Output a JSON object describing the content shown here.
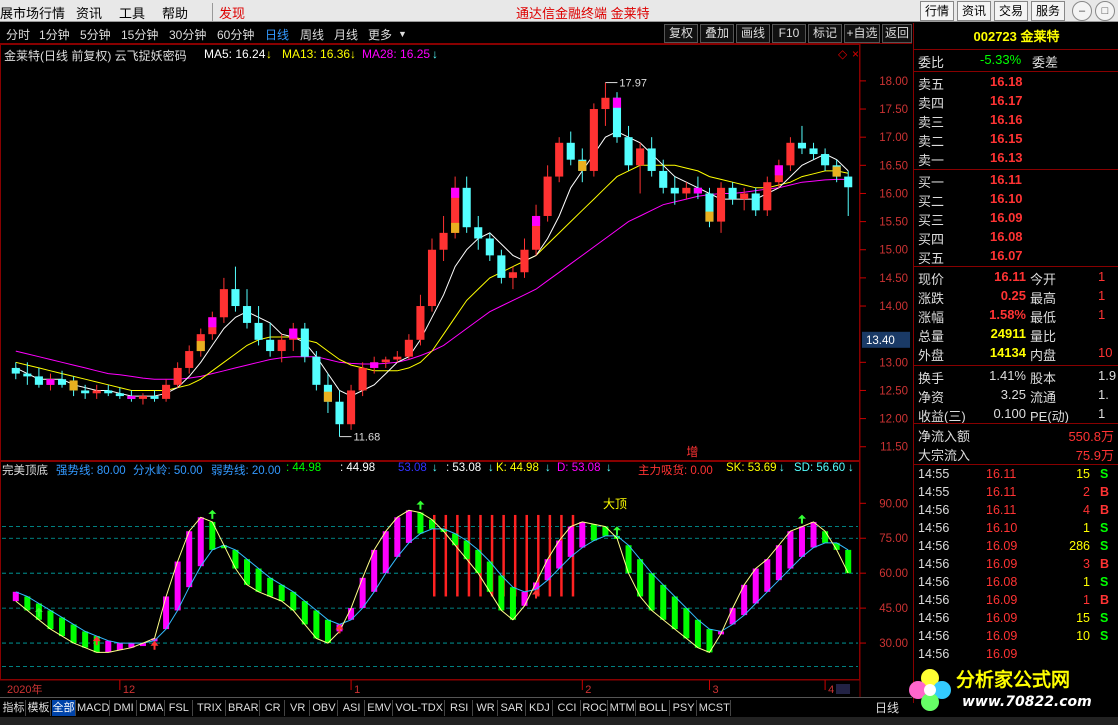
{
  "menu": {
    "items": [
      "展市场行情",
      "资讯",
      "工具",
      "帮助"
    ],
    "discover": "发现",
    "center_title": "通达信金融终端  金莱特",
    "right_buttons": [
      "行情",
      "资讯",
      "交易",
      "服务"
    ]
  },
  "period_bar": {
    "periods": [
      "分时",
      "1分钟",
      "5分钟",
      "15分钟",
      "30分钟",
      "60分钟",
      "日线",
      "周线",
      "月线",
      "更多"
    ],
    "active": "日线",
    "tools": [
      "复权",
      "叠加",
      "画线",
      "F10",
      "标记",
      "+自选",
      "返回"
    ]
  },
  "main_header": {
    "title": "金莱特(日线 前复权) 云飞捉妖密码",
    "ma5": "MA5: 16.24",
    "ma13": "MA13: 16.36",
    "ma28": "MA28: 16.25"
  },
  "price_axis": [
    "18.00",
    "17.50",
    "17.00",
    "16.50",
    "16.00",
    "15.50",
    "15.00",
    "14.50",
    "14.00",
    "13.40",
    "13.00",
    "12.50",
    "12.00",
    "11.50"
  ],
  "current_price_label": "13.40",
  "annotations": {
    "high": "17.97",
    "low": "11.68",
    "zeng": "增",
    "dading": "大顶"
  },
  "sub_header": {
    "name": "完美顶底",
    "strong": "强势线: 80.00",
    "water": "分水岭: 50.00",
    "weak": "弱势线: 20.00",
    "v1": ": 44.98",
    "v2": ": 44.98",
    "v3": "53.08",
    "v4": ": 53.08",
    "k": "K: 44.98",
    "d": "D: 53.08",
    "main": "主力吸货: 0.00",
    "sk": "SK: 53.69",
    "sd": "SD: 56.60"
  },
  "sub_axis": [
    "90.00",
    "75.00",
    "60.00",
    "45.00",
    "30.00"
  ],
  "date_axis": {
    "labels": [
      "2020年",
      "12",
      "1",
      "2",
      "3",
      "4"
    ]
  },
  "bottom_tabs": [
    "指标",
    "模板",
    "全部",
    "MACD",
    "DMI",
    "DMA",
    "FSL",
    "TRIX",
    "BRAR",
    "CR",
    "VR",
    "OBV",
    "ASI",
    "EMV",
    "VOL-TDX",
    "RSI",
    "WR",
    "SAR",
    "KDJ",
    "CCI",
    "ROC",
    "MTM",
    "BOLL",
    "PSY",
    "MCST"
  ],
  "bottom_active": "全部",
  "bottom_right": "日线",
  "quote": {
    "code": "002723 金莱特",
    "weibi_label": "委比",
    "weibi_value": "-5.33%",
    "weicha_label": "委差",
    "asks": [
      {
        "label": "卖五",
        "price": "16.18"
      },
      {
        "label": "卖四",
        "price": "16.17"
      },
      {
        "label": "卖三",
        "price": "16.16"
      },
      {
        "label": "卖二",
        "price": "16.15"
      },
      {
        "label": "卖一",
        "price": "16.13"
      }
    ],
    "bids": [
      {
        "label": "买一",
        "price": "16.11"
      },
      {
        "label": "买二",
        "price": "16.10"
      },
      {
        "label": "买三",
        "price": "16.09"
      },
      {
        "label": "买四",
        "price": "16.08"
      },
      {
        "label": "买五",
        "price": "16.07"
      }
    ],
    "stats": [
      {
        "l1": "现价",
        "v1": "16.11",
        "l2": "今开",
        "v2": "1"
      },
      {
        "l1": "涨跌",
        "v1": "0.25",
        "l2": "最高",
        "v2": "1"
      },
      {
        "l1": "涨幅",
        "v1": "1.58%",
        "l2": "最低",
        "v2": "1"
      },
      {
        "l1": "总量",
        "v1": "24911",
        "l2": "量比",
        "v2": ""
      },
      {
        "l1": "外盘",
        "v1": "14134",
        "l2": "内盘",
        "v2": "10"
      }
    ],
    "stats2": [
      {
        "l1": "换手",
        "v1": "1.41%",
        "l2": "股本",
        "v2": "1.9"
      },
      {
        "l1": "净资",
        "v1": "3.25",
        "l2": "流通",
        "v2": "1."
      },
      {
        "l1": "收益(三)",
        "v1": "0.100",
        "l2": "PE(动)",
        "v2": "1"
      }
    ],
    "flow": [
      {
        "label": "净流入额",
        "value": "550.8万"
      },
      {
        "label": "大宗流入",
        "value": "75.9万"
      }
    ],
    "ticks": [
      {
        "time": "14:55",
        "price": "16.11",
        "vol": "15",
        "side": "S"
      },
      {
        "time": "14:55",
        "price": "16.11",
        "vol": "2",
        "side": "B"
      },
      {
        "time": "14:56",
        "price": "16.11",
        "vol": "4",
        "side": "B"
      },
      {
        "time": "14:56",
        "price": "16.10",
        "vol": "1",
        "side": "S"
      },
      {
        "time": "14:56",
        "price": "16.09",
        "vol": "286",
        "side": "S"
      },
      {
        "time": "14:56",
        "price": "16.09",
        "vol": "3",
        "side": "B"
      },
      {
        "time": "14:56",
        "price": "16.08",
        "vol": "1",
        "side": "S"
      },
      {
        "time": "14:56",
        "price": "16.09",
        "vol": "1",
        "side": "B"
      },
      {
        "time": "14:56",
        "price": "16.09",
        "vol": "15",
        "side": "S"
      },
      {
        "time": "14:56",
        "price": "16.09",
        "vol": "10",
        "side": "S"
      },
      {
        "time": "14:56",
        "price": "16.09",
        "vol": "",
        "side": ""
      }
    ]
  },
  "watermark": {
    "text": "分析家公式网",
    "url": "www.70822.com"
  },
  "colors": {
    "up": "#ff3232",
    "down": "#54ffff",
    "ma5": "#ffffff",
    "ma13": "#ffff00",
    "ma28": "#ff00ff",
    "green": "#00ff00",
    "magenta": "#ff00ff"
  },
  "chart_data": {
    "type": "candlestick",
    "price_range": [
      11.3,
      18.3
    ],
    "candles": [
      [
        12.9,
        13.0,
        12.7,
        12.8
      ],
      [
        12.8,
        13.0,
        12.6,
        12.75
      ],
      [
        12.75,
        12.9,
        12.55,
        12.6
      ],
      [
        12.6,
        12.8,
        12.5,
        12.7
      ],
      [
        12.7,
        12.85,
        12.55,
        12.6
      ],
      [
        12.6,
        12.75,
        12.4,
        12.5
      ],
      [
        12.5,
        12.6,
        12.35,
        12.45
      ],
      [
        12.45,
        12.6,
        12.35,
        12.5
      ],
      [
        12.5,
        12.6,
        12.4,
        12.45
      ],
      [
        12.45,
        12.55,
        12.35,
        12.4
      ],
      [
        12.4,
        12.5,
        12.3,
        12.35
      ],
      [
        12.35,
        12.45,
        12.25,
        12.4
      ],
      [
        12.4,
        12.5,
        12.3,
        12.35
      ],
      [
        12.35,
        12.7,
        12.3,
        12.6
      ],
      [
        12.6,
        13.0,
        12.55,
        12.9
      ],
      [
        12.9,
        13.3,
        12.8,
        13.2
      ],
      [
        13.2,
        13.6,
        13.1,
        13.5
      ],
      [
        13.5,
        13.9,
        13.4,
        13.8
      ],
      [
        13.8,
        14.5,
        13.7,
        14.3
      ],
      [
        14.3,
        14.7,
        13.9,
        14.0
      ],
      [
        14.0,
        14.3,
        13.6,
        13.7
      ],
      [
        13.7,
        14.0,
        13.3,
        13.4
      ],
      [
        13.4,
        13.7,
        13.1,
        13.2
      ],
      [
        13.2,
        13.5,
        13.0,
        13.4
      ],
      [
        13.4,
        13.7,
        13.2,
        13.6
      ],
      [
        13.6,
        13.7,
        13.0,
        13.1
      ],
      [
        13.1,
        13.2,
        12.5,
        12.6
      ],
      [
        12.6,
        12.8,
        12.1,
        12.3
      ],
      [
        12.3,
        12.5,
        11.68,
        11.9
      ],
      [
        11.9,
        12.6,
        11.8,
        12.5
      ],
      [
        12.5,
        13.0,
        12.4,
        12.9
      ],
      [
        12.9,
        13.1,
        12.8,
        13.0
      ],
      [
        13.0,
        13.1,
        12.9,
        13.05
      ],
      [
        13.05,
        13.2,
        13.0,
        13.1
      ],
      [
        13.1,
        13.5,
        13.05,
        13.4
      ],
      [
        13.4,
        14.2,
        13.3,
        14.0
      ],
      [
        14.0,
        15.2,
        13.9,
        15.0
      ],
      [
        15.0,
        15.6,
        14.8,
        15.3
      ],
      [
        15.3,
        16.3,
        15.2,
        16.1
      ],
      [
        16.1,
        16.3,
        15.3,
        15.4
      ],
      [
        15.4,
        15.6,
        15.0,
        15.2
      ],
      [
        15.2,
        15.3,
        14.8,
        14.9
      ],
      [
        14.9,
        15.0,
        14.4,
        14.5
      ],
      [
        14.5,
        14.7,
        14.3,
        14.6
      ],
      [
        14.6,
        15.2,
        14.5,
        15.0
      ],
      [
        15.0,
        15.8,
        14.9,
        15.6
      ],
      [
        15.6,
        16.5,
        15.5,
        16.3
      ],
      [
        16.3,
        17.0,
        16.2,
        16.9
      ],
      [
        16.9,
        17.1,
        16.5,
        16.6
      ],
      [
        16.6,
        16.8,
        16.2,
        16.4
      ],
      [
        16.4,
        17.6,
        16.3,
        17.5
      ],
      [
        17.5,
        17.97,
        17.2,
        17.7
      ],
      [
        17.7,
        17.8,
        16.9,
        17.0
      ],
      [
        17.0,
        17.2,
        16.4,
        16.5
      ],
      [
        16.5,
        16.9,
        16.0,
        16.8
      ],
      [
        16.8,
        17.0,
        16.3,
        16.4
      ],
      [
        16.4,
        16.6,
        16.0,
        16.1
      ],
      [
        16.1,
        16.3,
        15.8,
        16.0
      ],
      [
        16.0,
        16.2,
        15.9,
        16.1
      ],
      [
        16.1,
        16.3,
        15.9,
        16.0
      ],
      [
        16.0,
        16.1,
        15.4,
        15.5
      ],
      [
        15.5,
        16.2,
        15.3,
        16.1
      ],
      [
        16.1,
        16.2,
        15.8,
        15.9
      ],
      [
        15.9,
        16.1,
        15.7,
        16.0
      ],
      [
        16.0,
        16.1,
        15.6,
        15.7
      ],
      [
        15.7,
        16.3,
        15.6,
        16.2
      ],
      [
        16.2,
        16.6,
        16.1,
        16.5
      ],
      [
        16.5,
        17.0,
        16.4,
        16.9
      ],
      [
        16.9,
        17.2,
        16.7,
        16.8
      ],
      [
        16.8,
        16.9,
        16.6,
        16.7
      ],
      [
        16.7,
        16.8,
        16.4,
        16.5
      ],
      [
        16.5,
        16.6,
        16.2,
        16.3
      ],
      [
        16.3,
        16.4,
        15.6,
        16.11
      ]
    ],
    "ma5": [
      12.9,
      12.8,
      12.7,
      12.7,
      12.7,
      12.6,
      12.55,
      12.5,
      12.5,
      12.45,
      12.4,
      12.4,
      12.4,
      12.45,
      12.55,
      12.75,
      13.0,
      13.3,
      13.6,
      13.8,
      13.9,
      13.8,
      13.7,
      13.5,
      13.45,
      13.35,
      13.1,
      12.8,
      12.5,
      12.4,
      12.5,
      12.6,
      12.8,
      13.0,
      13.1,
      13.4,
      13.8,
      14.2,
      14.7,
      15.0,
      15.2,
      15.3,
      15.1,
      14.9,
      14.8,
      14.9,
      15.2,
      15.6,
      16.1,
      16.4,
      16.7,
      17.0,
      17.1,
      17.0,
      16.9,
      16.7,
      16.5,
      16.3,
      16.2,
      16.1,
      16.0,
      15.9,
      15.9,
      15.9,
      15.9,
      16.0,
      16.1,
      16.3,
      16.5,
      16.6,
      16.7,
      16.6,
      16.4
    ],
    "ma13": [
      13.0,
      12.95,
      12.9,
      12.85,
      12.8,
      12.75,
      12.7,
      12.65,
      12.6,
      12.55,
      12.5,
      12.5,
      12.5,
      12.5,
      12.55,
      12.6,
      12.7,
      12.85,
      13.0,
      13.15,
      13.3,
      13.4,
      13.45,
      13.45,
      13.45,
      13.4,
      13.35,
      13.2,
      13.05,
      12.95,
      12.9,
      12.85,
      12.85,
      12.85,
      12.9,
      13.0,
      13.2,
      13.5,
      13.8,
      14.1,
      14.3,
      14.5,
      14.6,
      14.7,
      14.8,
      14.9,
      15.1,
      15.3,
      15.5,
      15.7,
      15.9,
      16.1,
      16.3,
      16.4,
      16.5,
      16.5,
      16.5,
      16.5,
      16.45,
      16.4,
      16.3,
      16.25,
      16.2,
      16.15,
      16.1,
      16.1,
      16.15,
      16.2,
      16.3,
      16.35,
      16.4,
      16.4,
      16.36
    ],
    "ma28": [
      13.2,
      13.15,
      13.1,
      13.05,
      13.0,
      12.95,
      12.9,
      12.85,
      12.8,
      12.78,
      12.75,
      12.72,
      12.7,
      12.7,
      12.7,
      12.72,
      12.75,
      12.8,
      12.85,
      12.9,
      12.95,
      13.0,
      13.05,
      13.08,
      13.1,
      13.1,
      13.1,
      13.05,
      13.0,
      12.98,
      12.97,
      12.97,
      12.98,
      13.0,
      13.05,
      13.12,
      13.2,
      13.3,
      13.45,
      13.6,
      13.75,
      13.9,
      14.0,
      14.1,
      14.2,
      14.3,
      14.45,
      14.6,
      14.75,
      14.9,
      15.05,
      15.2,
      15.35,
      15.5,
      15.6,
      15.7,
      15.8,
      15.85,
      15.9,
      15.95,
      15.98,
      16.0,
      16.0,
      16.02,
      16.05,
      16.08,
      16.1,
      16.15,
      16.2,
      16.22,
      16.24,
      16.25,
      16.25
    ],
    "indicator_k": [
      48,
      44,
      40,
      36,
      33,
      30,
      28,
      26,
      26,
      27,
      28,
      30,
      32,
      50,
      65,
      78,
      84,
      82,
      72,
      62,
      55,
      52,
      50,
      48,
      44,
      38,
      32,
      30,
      35,
      45,
      58,
      70,
      78,
      84,
      87,
      86,
      83,
      78,
      72,
      66,
      60,
      52,
      44,
      40,
      46,
      56,
      66,
      74,
      80,
      82,
      81,
      80,
      75,
      60,
      50,
      44,
      40,
      36,
      32,
      28,
      26,
      34,
      45,
      55,
      62,
      66,
      72,
      78,
      80,
      82,
      78,
      70,
      60
    ],
    "indicator_d": [
      52,
      50,
      47,
      44,
      41,
      38,
      35,
      33,
      31,
      30,
      30,
      30,
      31,
      36,
      44,
      54,
      63,
      70,
      72,
      70,
      66,
      62,
      58,
      55,
      52,
      48,
      44,
      40,
      38,
      40,
      45,
      52,
      60,
      67,
      73,
      77,
      79,
      79,
      77,
      74,
      70,
      65,
      59,
      54,
      52,
      53,
      57,
      62,
      67,
      71,
      74,
      76,
      76,
      72,
      66,
      60,
      55,
      50,
      45,
      40,
      36,
      35,
      38,
      42,
      47,
      52,
      57,
      62,
      67,
      71,
      73,
      73,
      70
    ]
  }
}
